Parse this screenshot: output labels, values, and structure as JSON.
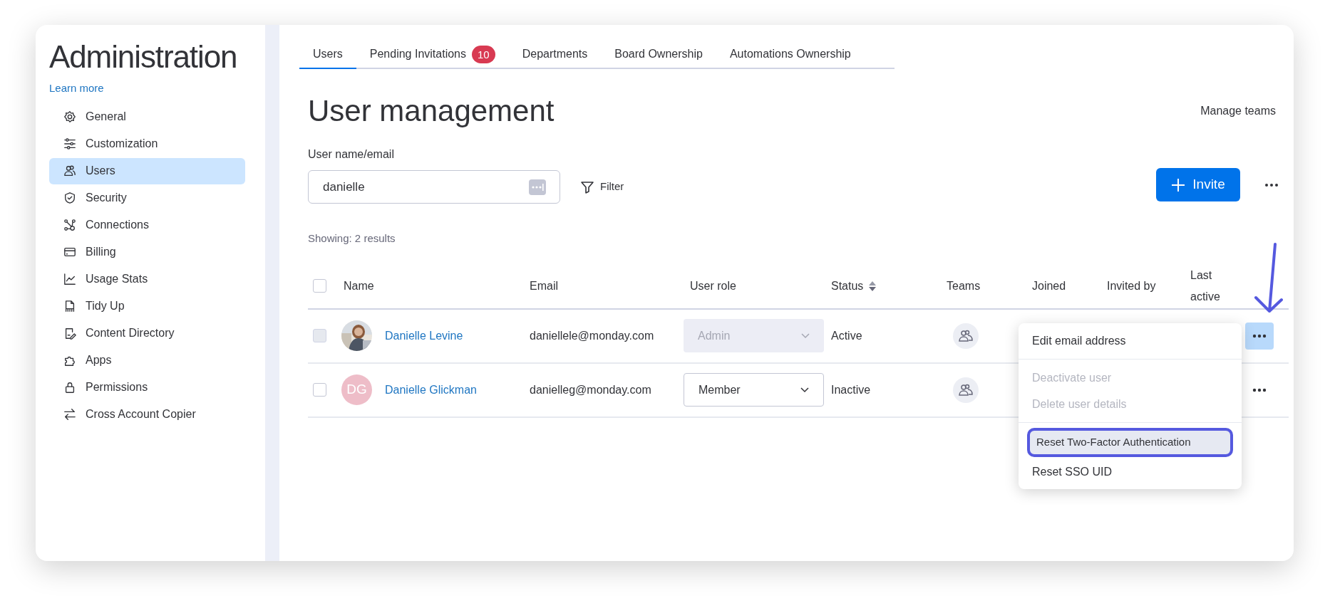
{
  "sidebar": {
    "title": "Administration",
    "link": "Learn more",
    "items": [
      {
        "label": "General",
        "selected": false
      },
      {
        "label": "Customization",
        "selected": false
      },
      {
        "label": "Users",
        "selected": true
      },
      {
        "label": "Security",
        "selected": false
      },
      {
        "label": "Connections",
        "selected": false
      },
      {
        "label": "Billing",
        "selected": false
      },
      {
        "label": "Usage Stats",
        "selected": false
      },
      {
        "label": "Tidy Up",
        "selected": false
      },
      {
        "label": "Content Directory",
        "selected": false
      },
      {
        "label": "Apps",
        "selected": false
      },
      {
        "label": "Permissions",
        "selected": false
      },
      {
        "label": "Cross Account Copier",
        "selected": false
      }
    ]
  },
  "tabs": [
    {
      "label": "Users",
      "selected": true
    },
    {
      "label": "Pending Invitations",
      "badge": "10",
      "selected": false
    },
    {
      "label": "Departments",
      "selected": false
    },
    {
      "label": "Board Ownership",
      "selected": false
    },
    {
      "label": "Automations Ownership",
      "selected": false
    }
  ],
  "heading": "User management",
  "manage_teams": "Manage teams",
  "search": {
    "label": "User name/email",
    "value": "danielle"
  },
  "filter": "Filter",
  "invite": "Invite",
  "results": "Showing: 2 results",
  "table": {
    "select_all_checked": false,
    "columns": [
      "Name",
      "Email",
      "User role",
      "Status",
      "Teams",
      "Joined",
      "Invited by",
      "Last active"
    ],
    "rows": [
      {
        "name": "Danielle Levine",
        "email": "daniellele@monday.com",
        "role": "Admin",
        "role_disabled": true,
        "checkbox_disabled": true,
        "status": "Active",
        "menu_open": true
      },
      {
        "name": "Danielle Glickman",
        "avatar": {
          "kind": "initials",
          "text": "DG",
          "color": "#eebdc8"
        },
        "email": "danielleg@monday.com",
        "role": "Member",
        "role_disabled": false,
        "checkbox_disabled": false,
        "status": "Inactive",
        "menu_open": false
      }
    ]
  },
  "context_menu": {
    "items": [
      {
        "label": "Edit email address",
        "disabled": false,
        "highlighted": false,
        "divider_after": true
      },
      {
        "label": "Deactivate user",
        "disabled": true,
        "highlighted": false,
        "divider_after": false
      },
      {
        "label": "Delete user details",
        "disabled": true,
        "highlighted": false,
        "divider_after": true
      },
      {
        "label": "Reset Two-Factor Authentication",
        "disabled": false,
        "highlighted": true,
        "divider_after": false
      },
      {
        "label": "Reset SSO UID",
        "disabled": false,
        "highlighted": false,
        "divider_after": false
      }
    ]
  }
}
